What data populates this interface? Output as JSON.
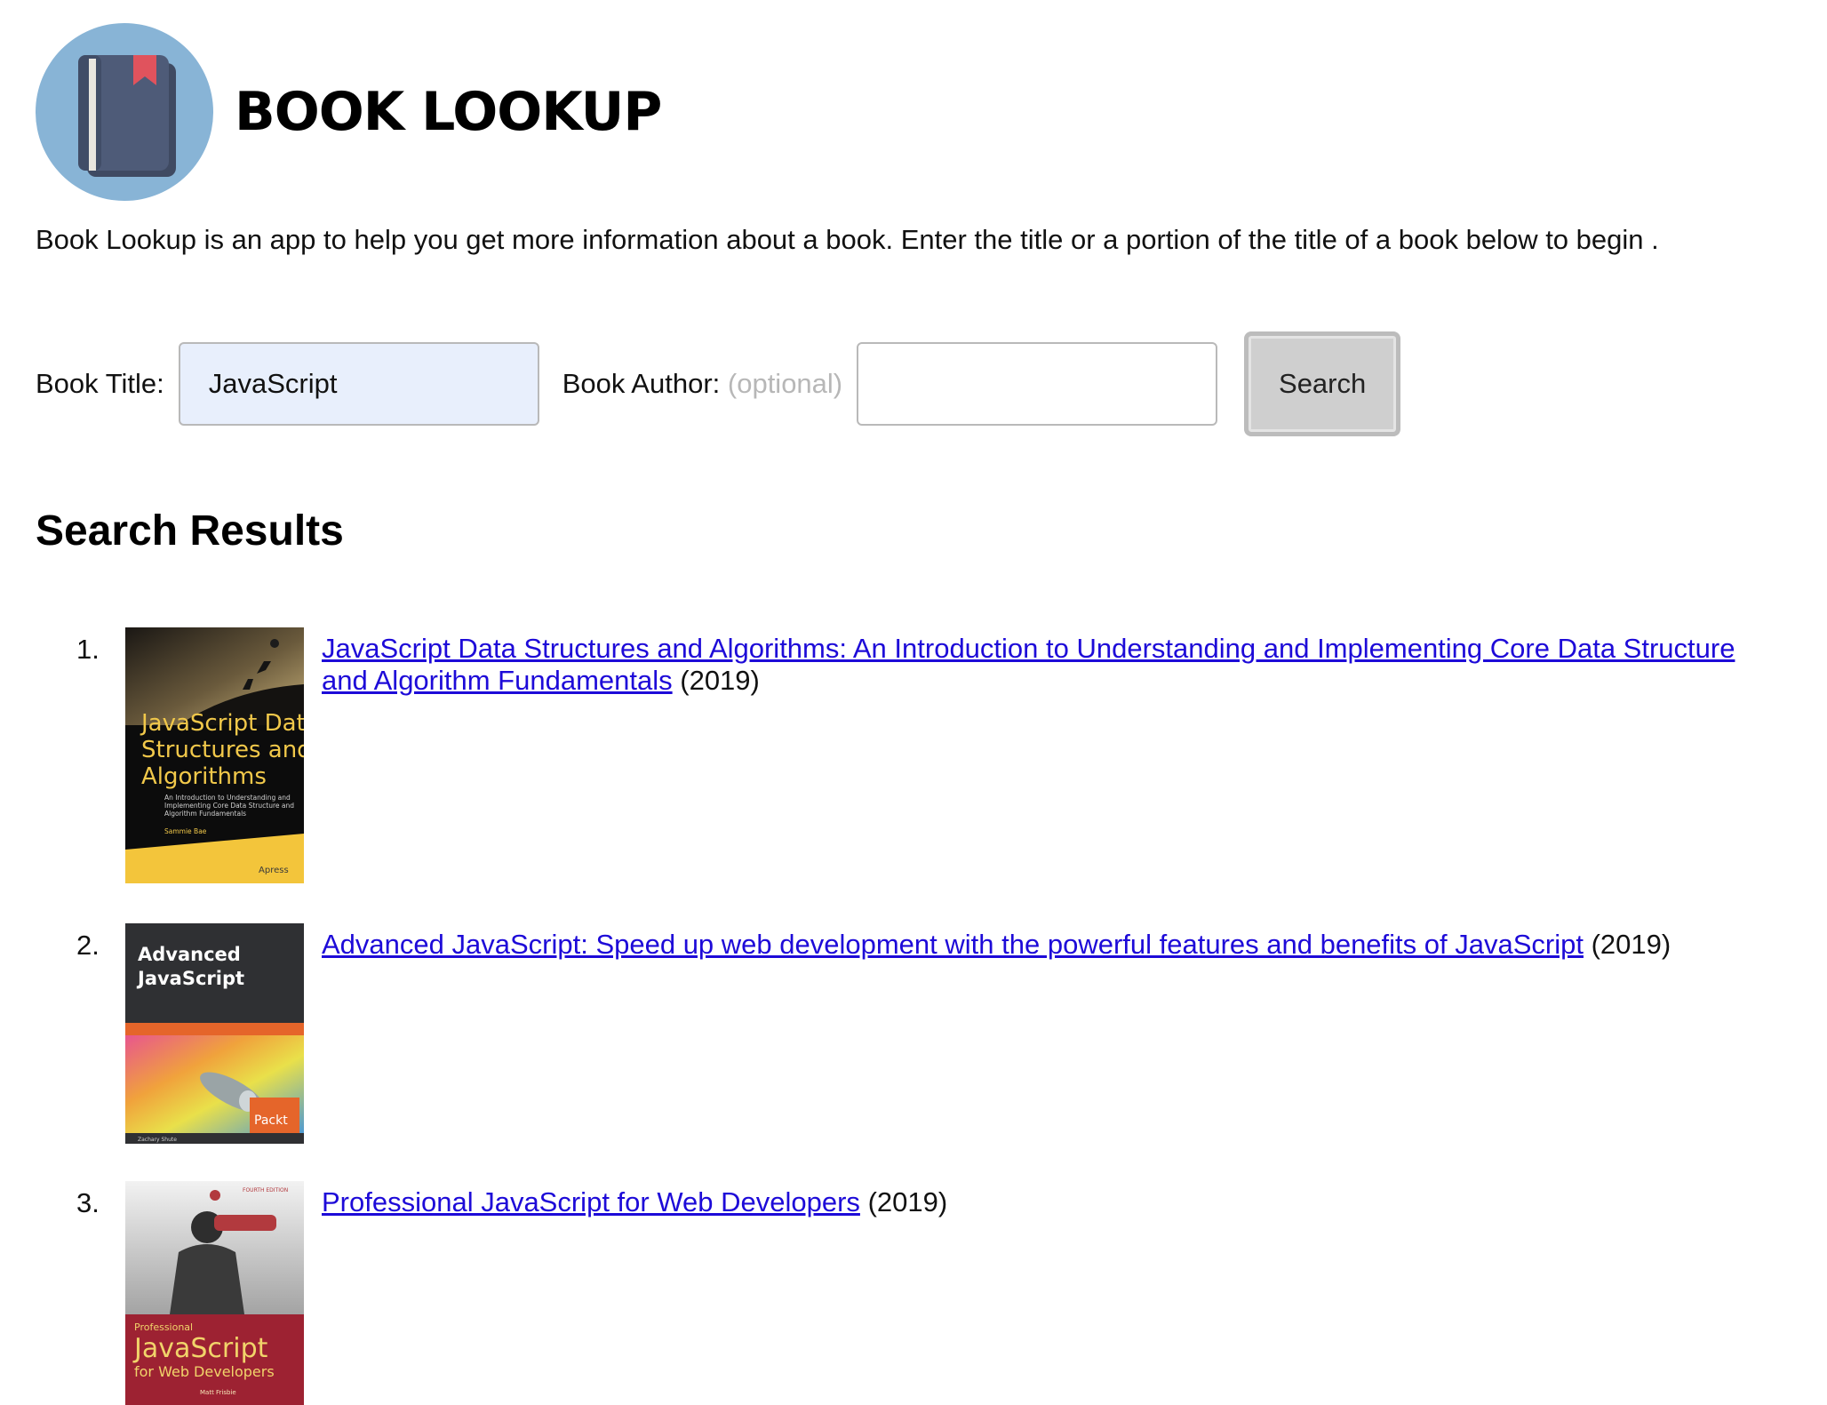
{
  "header": {
    "logo_icon": "book-icon",
    "title": "BOOK LOOKUP"
  },
  "intro": "Book Lookup is an app to help you get more information about a book. Enter the title or a portion of the title of a book below to begin .",
  "form": {
    "title_label": "Book Title:",
    "title_value": "JavaScript",
    "author_label": "Book Author:",
    "author_optional": "(optional)",
    "author_value": "",
    "search_label": "Search"
  },
  "results": {
    "heading": "Search Results",
    "items": [
      {
        "number": "1.",
        "title": "JavaScript Data Structures and Algorithms: An Introduction to Understanding and Implementing Core Data Structure and Algorithm Fundamentals",
        "year": "(2019)",
        "cover": {
          "title_lines": [
            "JavaScript Data",
            "Structures and",
            "Algorithms"
          ],
          "subtitle_lines": [
            "An Introduction to Understanding and",
            "Implementing Core Data Structure and",
            "Algorithm Fundamentals"
          ],
          "author": "Sammie Bae",
          "publisher": "Apress"
        }
      },
      {
        "number": "2.",
        "title": "Advanced JavaScript: Speed up web development with the powerful features and benefits of JavaScript",
        "year": "(2019)",
        "cover": {
          "title_lines": [
            "Advanced",
            "JavaScript"
          ],
          "author": "Zachary Shute",
          "publisher": "Packt"
        }
      },
      {
        "number": "3.",
        "title": "Professional JavaScript for Web Developers",
        "year": "(2019)",
        "cover": {
          "edition": "FOURTH EDITION",
          "kicker": "Professional",
          "title_lines": [
            "JavaScript",
            "for Web Developers"
          ],
          "author": "Matt Frisbie"
        }
      }
    ]
  }
}
